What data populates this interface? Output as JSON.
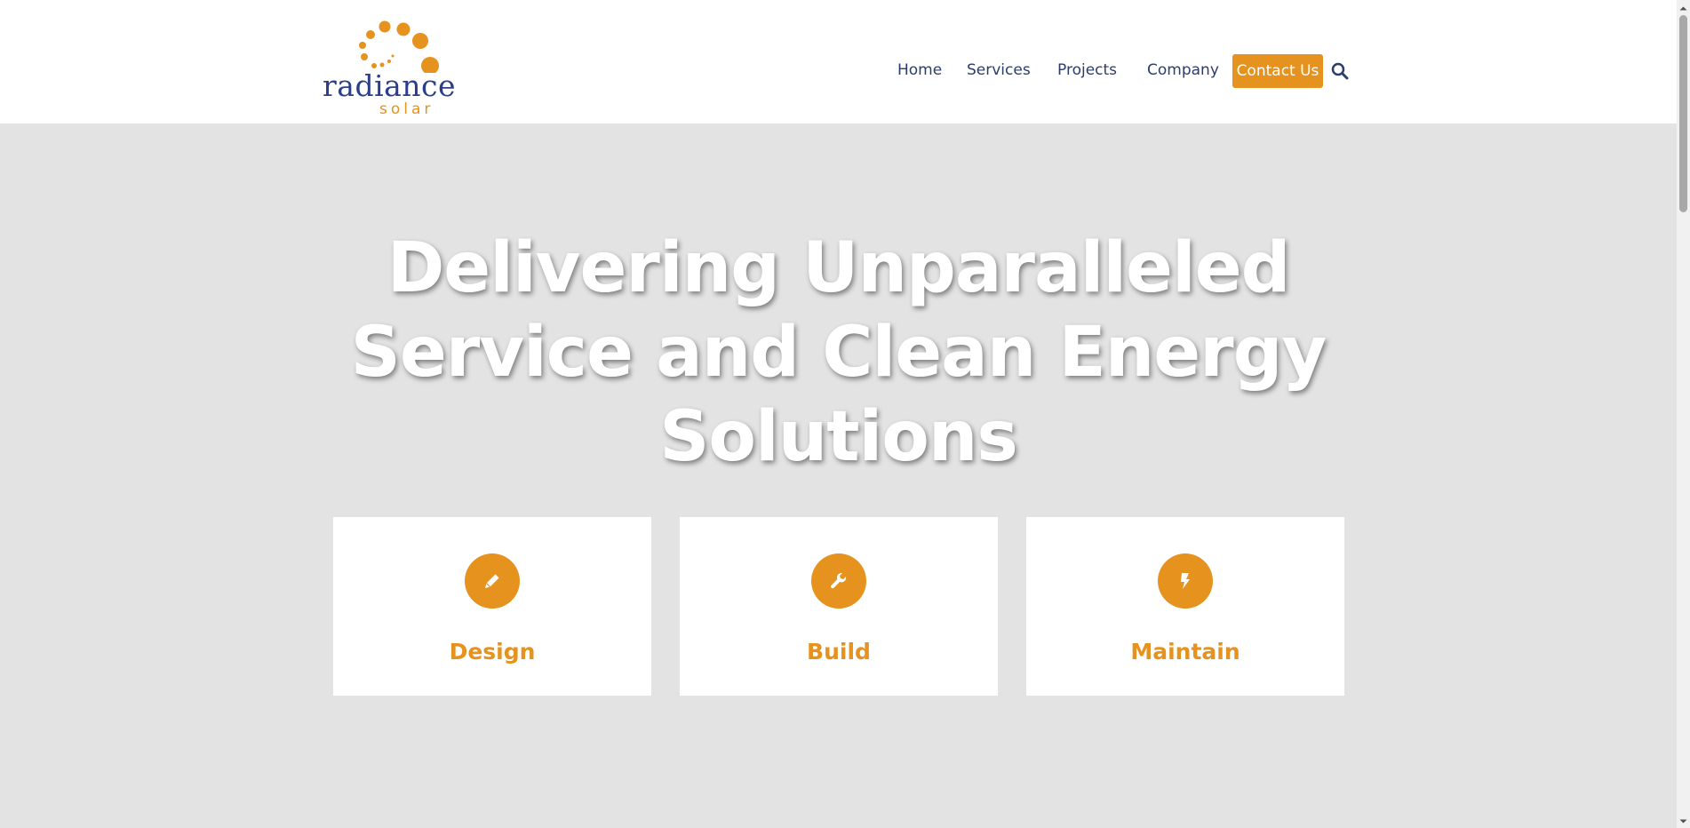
{
  "logo": {
    "name": "radiance",
    "sub": "solar"
  },
  "nav": {
    "home": "Home",
    "services": "Services",
    "projects": "Projects",
    "company": "Company",
    "contact": "Contact Us",
    "search_icon": "search-icon"
  },
  "hero": {
    "line1": "Delivering Unparalleled",
    "line2": "Service and Clean Energy",
    "line3": "Solutions"
  },
  "cards": [
    {
      "title": "Design",
      "icon": "pencil-icon"
    },
    {
      "title": "Build",
      "icon": "wrench-icon"
    },
    {
      "title": "Maintain",
      "icon": "bolt-icon"
    }
  ],
  "colors": {
    "accent": "#e6921e",
    "brand_blue": "#2b3e8a",
    "hero_bg": "#e3e3e3"
  }
}
